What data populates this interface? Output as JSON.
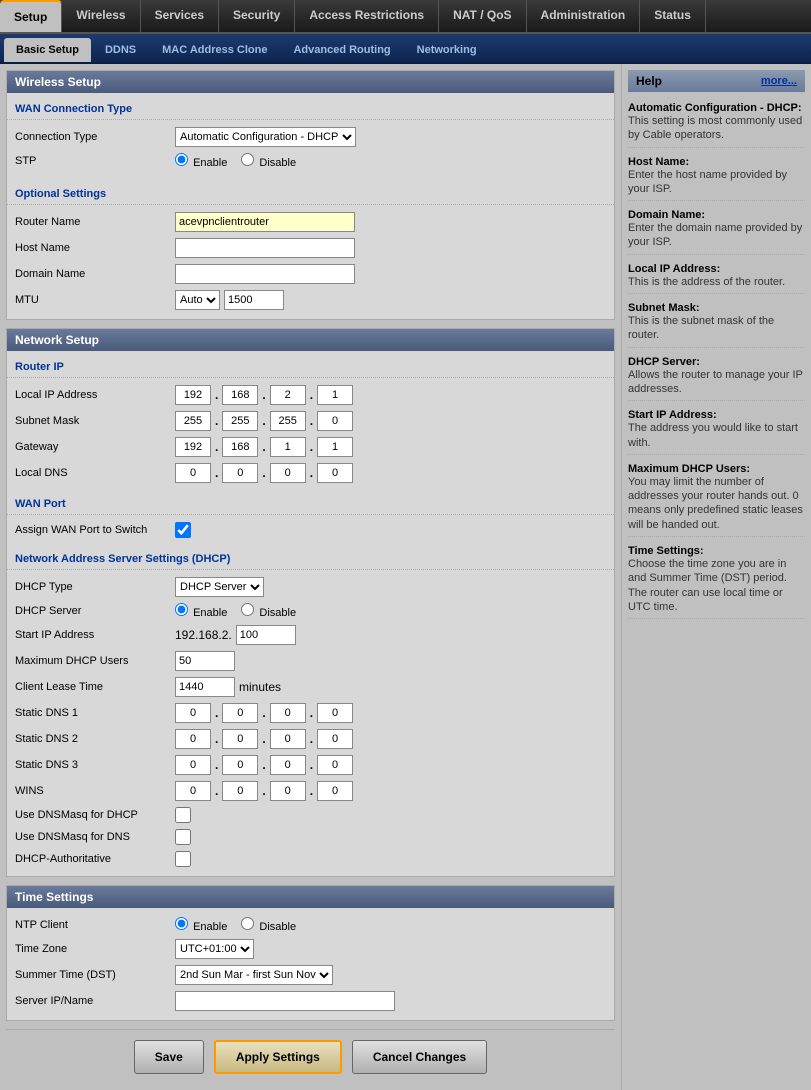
{
  "topNav": {
    "tabs": [
      {
        "id": "setup",
        "label": "Setup",
        "active": true
      },
      {
        "id": "wireless",
        "label": "Wireless",
        "active": false
      },
      {
        "id": "services",
        "label": "Services",
        "active": false
      },
      {
        "id": "security",
        "label": "Security",
        "active": false
      },
      {
        "id": "access-restrictions",
        "label": "Access Restrictions",
        "active": false
      },
      {
        "id": "nat-qos",
        "label": "NAT / QoS",
        "active": false
      },
      {
        "id": "administration",
        "label": "Administration",
        "active": false
      },
      {
        "id": "status",
        "label": "Status",
        "active": false
      }
    ]
  },
  "subNav": {
    "tabs": [
      {
        "id": "basic-setup",
        "label": "Basic Setup",
        "active": true
      },
      {
        "id": "ddns",
        "label": "DDNS",
        "active": false
      },
      {
        "id": "mac-address-clone",
        "label": "MAC Address Clone",
        "active": false
      },
      {
        "id": "advanced-routing",
        "label": "Advanced Routing",
        "active": false
      },
      {
        "id": "networking",
        "label": "Networking",
        "active": false
      }
    ]
  },
  "main": {
    "sectionTitle": "Wireless Setup",
    "wan": {
      "title": "WAN Connection Type",
      "connectionTypeLabel": "Connection Type",
      "connectionTypeValue": "Automatic Configuration - DHCP",
      "stpLabel": "STP",
      "stpEnableLabel": "Enable",
      "stpDisableLabel": "Disable"
    },
    "optional": {
      "title": "Optional Settings",
      "routerNameLabel": "Router Name",
      "routerNameValue": "acevpnclientrouter",
      "hostNameLabel": "Host Name",
      "hostNameValue": "",
      "domainNameLabel": "Domain Name",
      "domainNameValue": "",
      "mtuLabel": "MTU",
      "mtuSelectValue": "Auto",
      "mtuValue": "1500"
    },
    "network": {
      "title": "Network Setup",
      "routerIP": {
        "title": "Router IP",
        "localIPLabel": "Local IP Address",
        "localIP": [
          "192",
          "168",
          "2",
          "1"
        ],
        "subnetMaskLabel": "Subnet Mask",
        "subnetMask": [
          "255",
          "255",
          "255",
          "0"
        ],
        "gatewayLabel": "Gateway",
        "gateway": [
          "192",
          "168",
          "1",
          "1"
        ],
        "localDNSLabel": "Local DNS",
        "localDNS": [
          "0",
          "0",
          "0",
          "0"
        ]
      },
      "wanPort": {
        "title": "WAN Port",
        "assignLabel": "Assign WAN Port to Switch",
        "assignChecked": true
      },
      "dhcp": {
        "title": "Network Address Server Settings (DHCP)",
        "dhcpTypeLabel": "DHCP Type",
        "dhcpTypeValue": "DHCP Server",
        "dhcpServerLabel": "DHCP Server",
        "dhcpEnableLabel": "Enable",
        "dhcpDisableLabel": "Disable",
        "startIPLabel": "Start IP Address",
        "startIPPrefix": "192.168.2.",
        "startIPValue": "100",
        "maxUsersLabel": "Maximum DHCP Users",
        "maxUsersValue": "50",
        "clientLeaseLabel": "Client Lease Time",
        "clientLeaseValue": "1440",
        "clientLeaseUnit": "minutes",
        "staticDNS1Label": "Static DNS 1",
        "staticDNS1": [
          "0",
          "0",
          "0",
          "0"
        ],
        "staticDNS2Label": "Static DNS 2",
        "staticDNS2": [
          "0",
          "0",
          "0",
          "0"
        ],
        "staticDNS3Label": "Static DNS 3",
        "staticDNS3": [
          "0",
          "0",
          "0",
          "0"
        ],
        "winsLabel": "WINS",
        "wins": [
          "0",
          "0",
          "0",
          "0"
        ],
        "useDNSMasqDHCPLabel": "Use DNSMasq for DHCP",
        "useDNSMasqDNSLabel": "Use DNSMasq for DNS",
        "dhcpAuthLabel": "DHCP-Authoritative"
      }
    },
    "time": {
      "title": "Time Settings",
      "ntpLabel": "NTP Client",
      "ntpEnableLabel": "Enable",
      "ntpDisableLabel": "Disable",
      "timezoneLabel": "Time Zone",
      "timezoneValue": "UTC+01:00",
      "summerTimeLabel": "Summer Time (DST)",
      "summerTimeValue": "2nd Sun Mar - first Sun Nov",
      "serverIPLabel": "Server IP/Name",
      "serverIPValue": ""
    }
  },
  "help": {
    "title": "Help",
    "moreLabel": "more...",
    "items": [
      {
        "title": "Automatic Configuration - DHCP:",
        "text": "This setting is most commonly used by Cable operators."
      },
      {
        "title": "Host Name:",
        "text": "Enter the host name provided by your ISP."
      },
      {
        "title": "Domain Name:",
        "text": "Enter the domain name provided by your ISP."
      },
      {
        "title": "Local IP Address:",
        "text": "This is the address of the router."
      },
      {
        "title": "Subnet Mask:",
        "text": "This is the subnet mask of the router."
      },
      {
        "title": "DHCP Server:",
        "text": "Allows the router to manage your IP addresses."
      },
      {
        "title": "Start IP Address:",
        "text": "The address you would like to start with."
      },
      {
        "title": "Maximum DHCP Users:",
        "text": "You may limit the number of addresses your router hands out. 0 means only predefined static leases will be handed out."
      },
      {
        "title": "Time Settings:",
        "text": "Choose the time zone you are in and Summer Time (DST) period. The router can use local time or UTC time."
      }
    ]
  },
  "buttons": {
    "save": "Save",
    "apply": "Apply Settings",
    "cancel": "Cancel Changes"
  }
}
